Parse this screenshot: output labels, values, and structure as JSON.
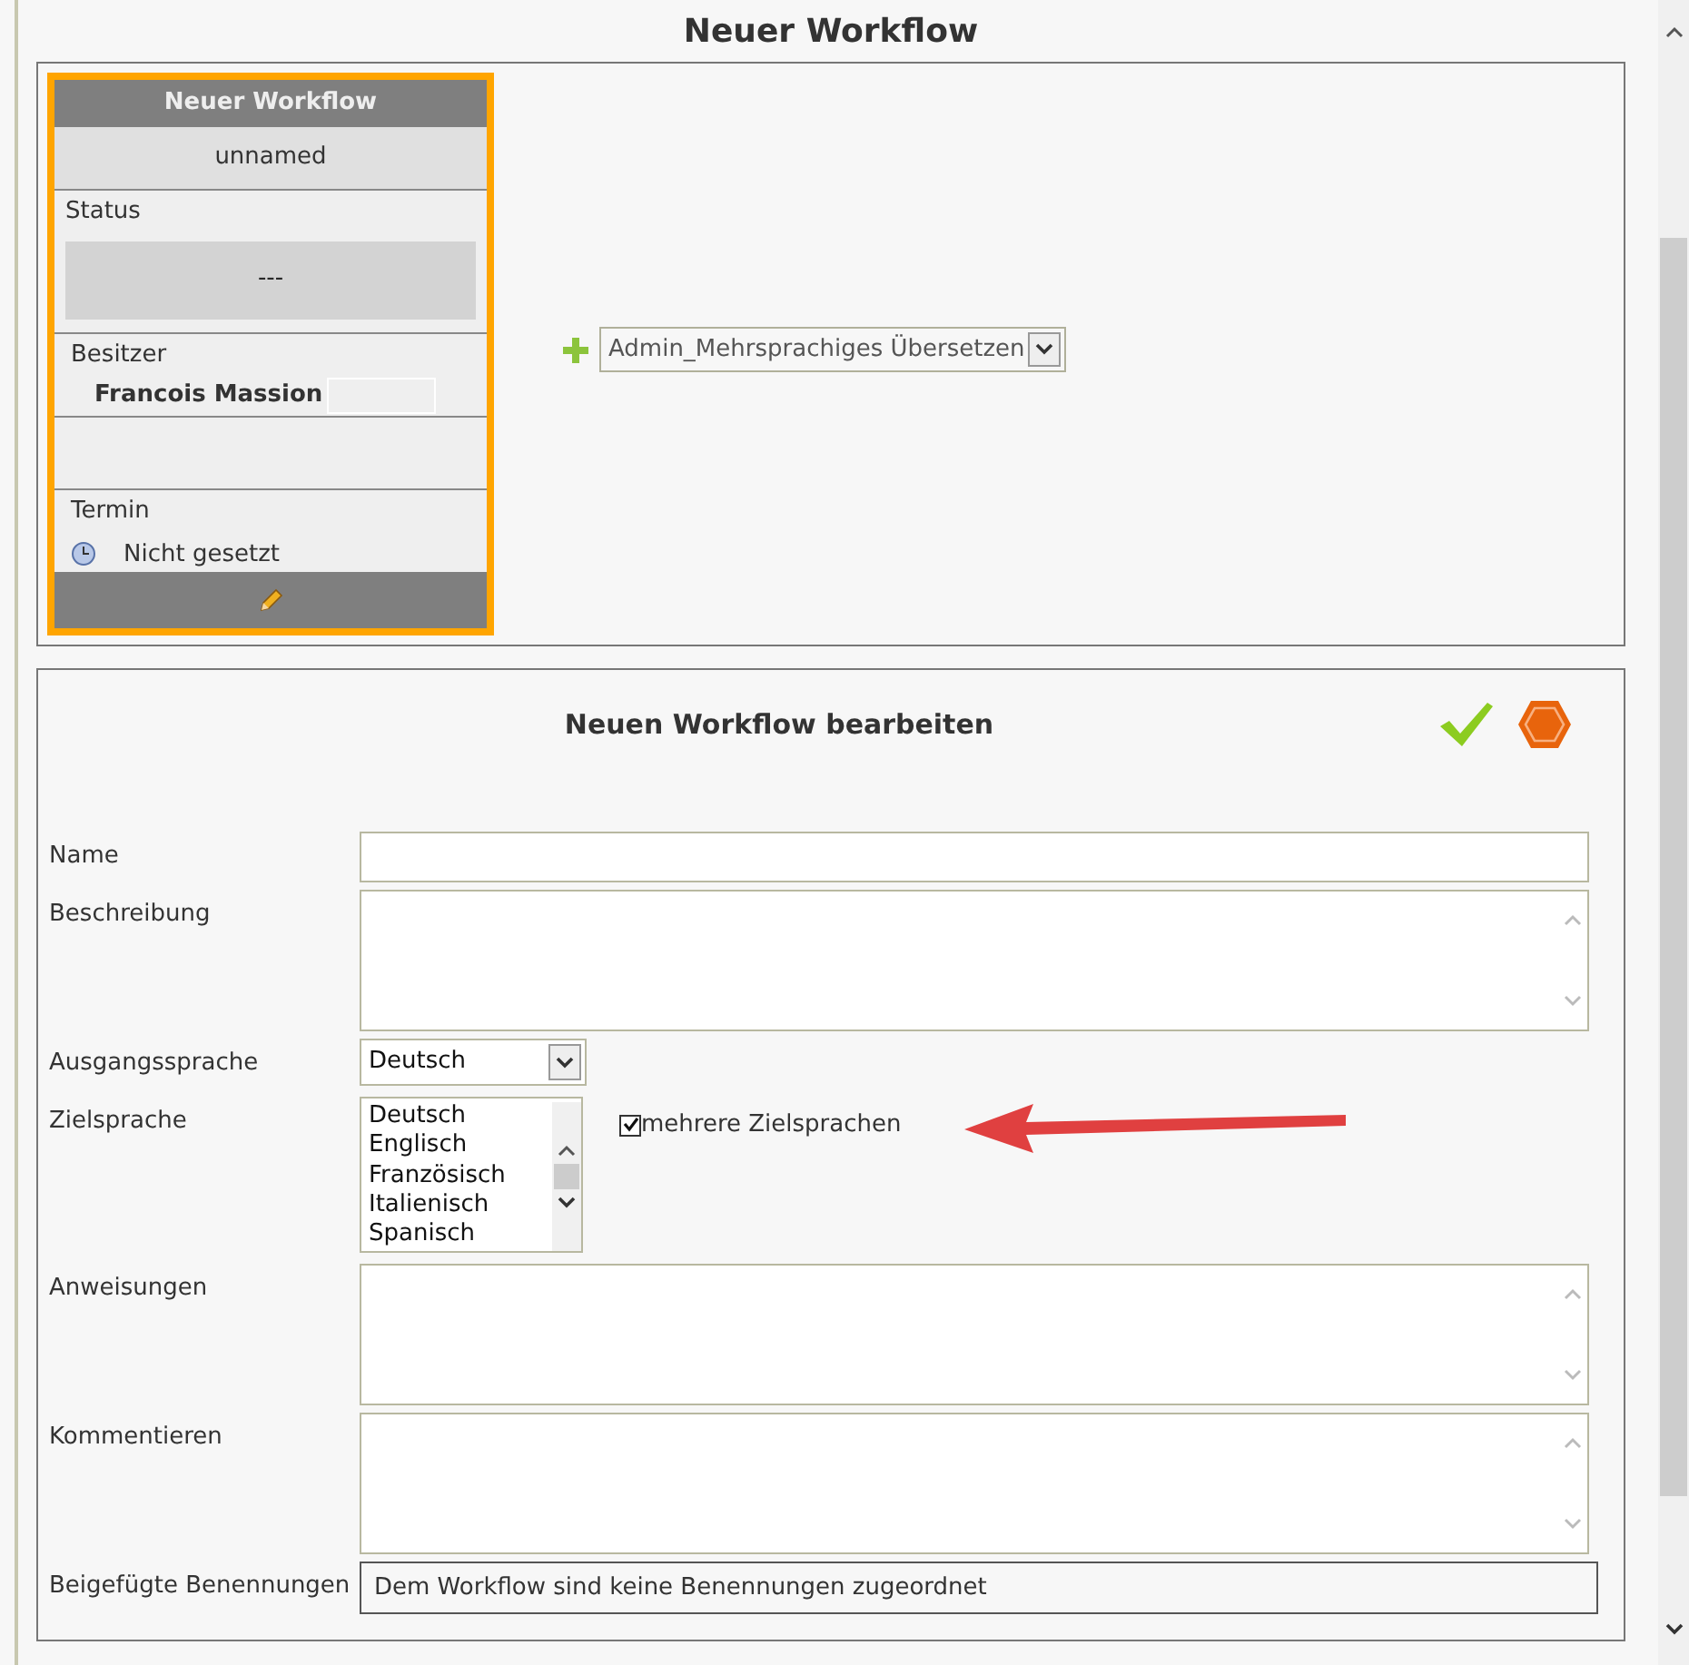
{
  "page_title": "Neuer Workflow",
  "card": {
    "header": "Neuer Workflow",
    "name": "unnamed",
    "status_label": "Status",
    "status_value": "---",
    "owner_label": "Besitzer",
    "owner": "Francois Massion",
    "deadline_label": "Termin",
    "deadline": "Nicht gesetzt"
  },
  "template_select": {
    "value": "Admin_Mehrsprachiges Übersetzen"
  },
  "form": {
    "title": "Neuen Workflow bearbeiten",
    "name_label": "Name",
    "description_label": "Beschreibung",
    "source_label": "Ausgangssprache",
    "source_value": "Deutsch",
    "target_label": "Zielsprache",
    "target_options": [
      "Deutsch",
      "Englisch",
      "Französisch",
      "Italienisch",
      "Spanisch"
    ],
    "multi_target": {
      "label": "mehrere Zielsprachen",
      "checked": true
    },
    "instructions_label": "Anweisungen",
    "comment_label": "Kommentieren",
    "terms_label": "Beigefügte Benennungen",
    "terms_value": "Dem Workflow sind keine Benennungen zugeordnet"
  }
}
